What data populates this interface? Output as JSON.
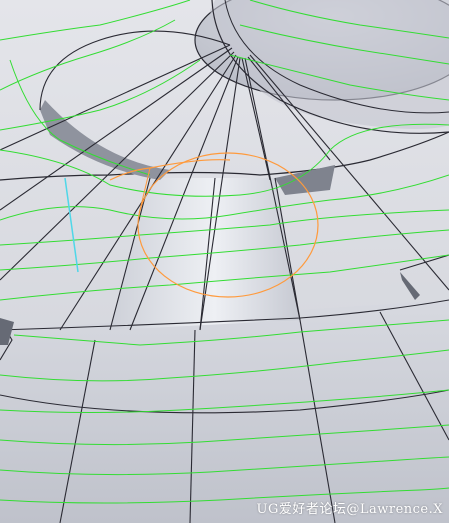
{
  "watermark": "UG爱好者论坛@Lawrence.X",
  "colors": {
    "surface_light": "#e8e9ee",
    "surface_mid": "#d4d6dd",
    "surface_dark": "#b9bcc6",
    "edge": "#2a2a33",
    "toolpath": "#33dd33",
    "tool_circle": "#ff9a3c",
    "axis_line": "#4fd7e8"
  },
  "icons": {
    "tool_circle": "tool-radius-circle",
    "toolpath": "toolpath-curve"
  }
}
